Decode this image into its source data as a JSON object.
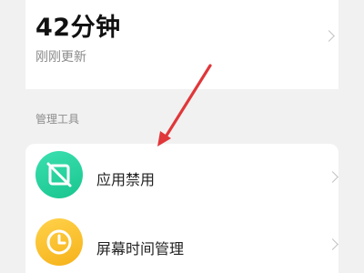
{
  "usage": {
    "total_time": "42分钟",
    "updated": "刚刚更新"
  },
  "section": {
    "title": "管理工具"
  },
  "tools": [
    {
      "label": "应用禁用",
      "icon": "app-block-icon",
      "color": "#22cf98"
    },
    {
      "label": "屏幕时间管理",
      "icon": "clock-icon",
      "color": "#f8be2c"
    }
  ],
  "annotation": {
    "arrow_color": "#e0373a"
  }
}
